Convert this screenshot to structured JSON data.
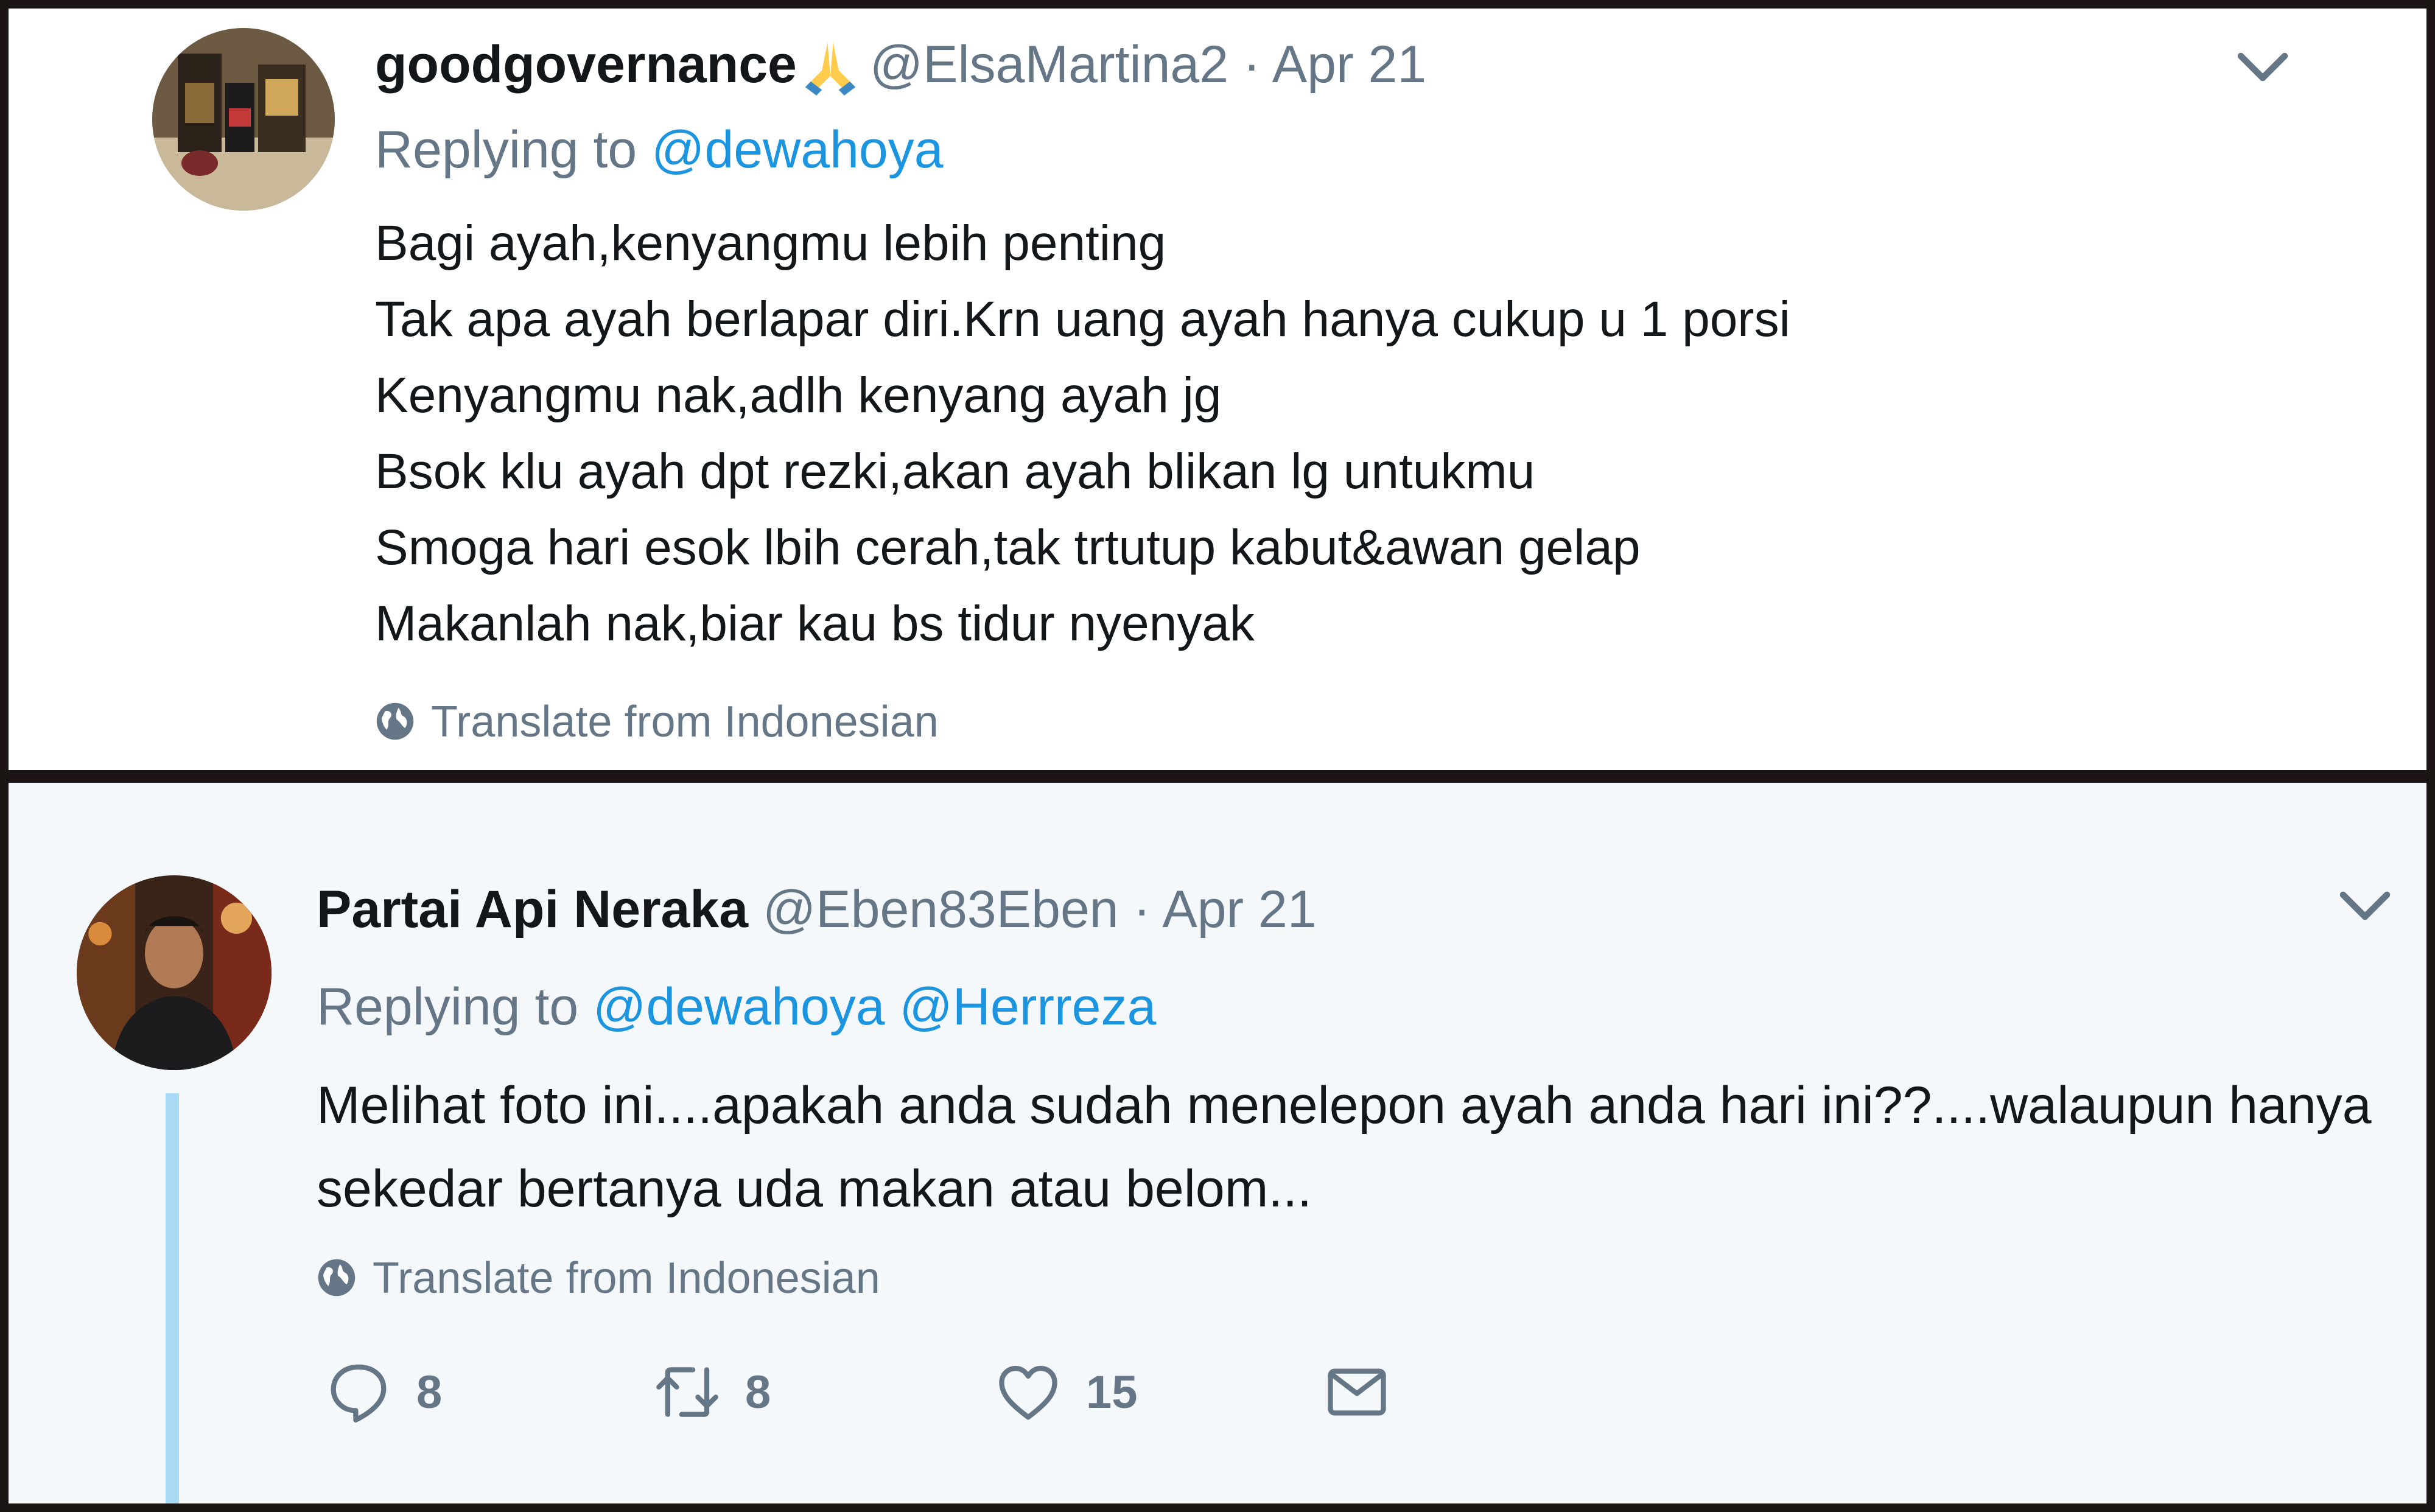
{
  "tweets": [
    {
      "display_name": "goodgovernance",
      "handle": "@ElsaMartina2",
      "separator": "·",
      "date": "Apr 21",
      "replying_label": "Replying to",
      "mentions": [
        "@dewahoya"
      ],
      "lines": [
        "Bagi ayah,kenyangmu lebih penting",
        "Tak apa ayah berlapar diri.Krn uang ayah hanya cukup u 1 porsi",
        "Kenyangmu nak,adlh kenyang ayah jg",
        "Bsok klu ayah dpt rezki,akan ayah blikan lg untukmu",
        "Smoga hari esok lbih cerah,tak trtutup kabut&awan gelap",
        "Makanlah nak,biar kau bs tidur nyenyak"
      ],
      "translate_label": "Translate from Indonesian"
    },
    {
      "display_name": "Partai Api Neraka",
      "handle": "@Eben83Eben",
      "separator": "·",
      "date": "Apr 21",
      "replying_label": "Replying to",
      "mentions": [
        "@dewahoya",
        "@Herrreza"
      ],
      "text": "Melihat foto ini....apakah anda sudah menelepon ayah anda hari ini??....walaupun hanya sekedar bertanya uda makan atau belom...",
      "translate_label": "Translate from Indonesian",
      "actions": {
        "replies": "8",
        "retweets": "8",
        "likes": "15"
      }
    }
  ],
  "colors": {
    "link": "#1b95e0",
    "muted": "#657786",
    "text": "#14171a",
    "thread_line": "#a9d9f5",
    "bottom_panel_bg": "#f5f8fa",
    "frame": "#1b1514"
  },
  "icons": {
    "name_emoji": "folded-hands-emoji",
    "translate": "globe-icon",
    "menu": "chevron-down-icon",
    "reply": "reply-icon",
    "retweet": "retweet-icon",
    "like": "heart-icon",
    "dm": "envelope-icon"
  }
}
